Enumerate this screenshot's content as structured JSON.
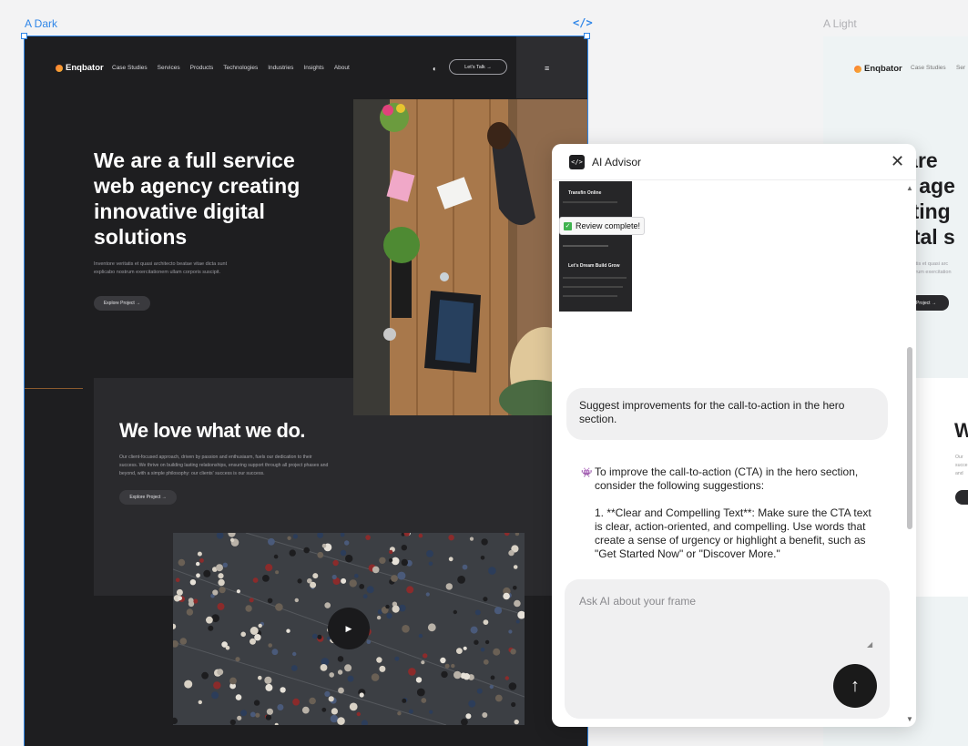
{
  "canvas": {
    "dark_label": "A Dark",
    "light_label": "A Light",
    "code_icon": "</>"
  },
  "site": {
    "logo": "Enqbator",
    "nav": [
      "Case Studies",
      "Services",
      "Products",
      "Technologies",
      "Industries",
      "Insights",
      "About"
    ],
    "cta": "Let's Talk →",
    "hero_title": "We are a full service web agency creating innovative digital solutions",
    "hero_text": "Inventore veritatis et quasi architecto beatae vitae dicta sunt explicabo nostrum exercitationem ullam corporis suscipit.",
    "hero_button": "Explore Project →",
    "love_title": "We love what we do.",
    "love_text": "Our client-focused approach, driven by passion and enthusiasm, fuels our dedication to their success. We thrive on building lasting relationships, ensuring support through all project phases and beyond, with a simple philosophy: our clients' success is our success.",
    "love_button": "Explore Project →"
  },
  "light_site": {
    "case": "Case Studies",
    "ser": "Ser",
    "hero_lines": [
      "e are",
      "eb age",
      "eating",
      "igital s"
    ],
    "text_lines": [
      "entatis et quasi arc",
      "nostrum exercitation"
    ],
    "button": "Project →",
    "w": "W",
    "snip": [
      "Our",
      "succe",
      "and"
    ]
  },
  "advisor": {
    "title": "AI Advisor",
    "close": "✕",
    "thumb_title_1": "Transfin Online",
    "thumb_title_2": "Let's Dream Build Grow",
    "review_badge": "Review complete!",
    "user_message": "Suggest improvements for the call-to-action in the hero section.",
    "ai_paragraph_1": "To improve the call-to-action (CTA) in the hero section, consider the following suggestions:",
    "ai_paragraph_2": "1. **Clear and Compelling Text**: Make sure the CTA text is clear, action-oriented, and compelling. Use words that create a sense of urgency or highlight a benefit, such as \"Get Started Now\" or \"Discover More.\"",
    "input_placeholder": "Ask AI about your frame",
    "send_icon": "↑"
  }
}
